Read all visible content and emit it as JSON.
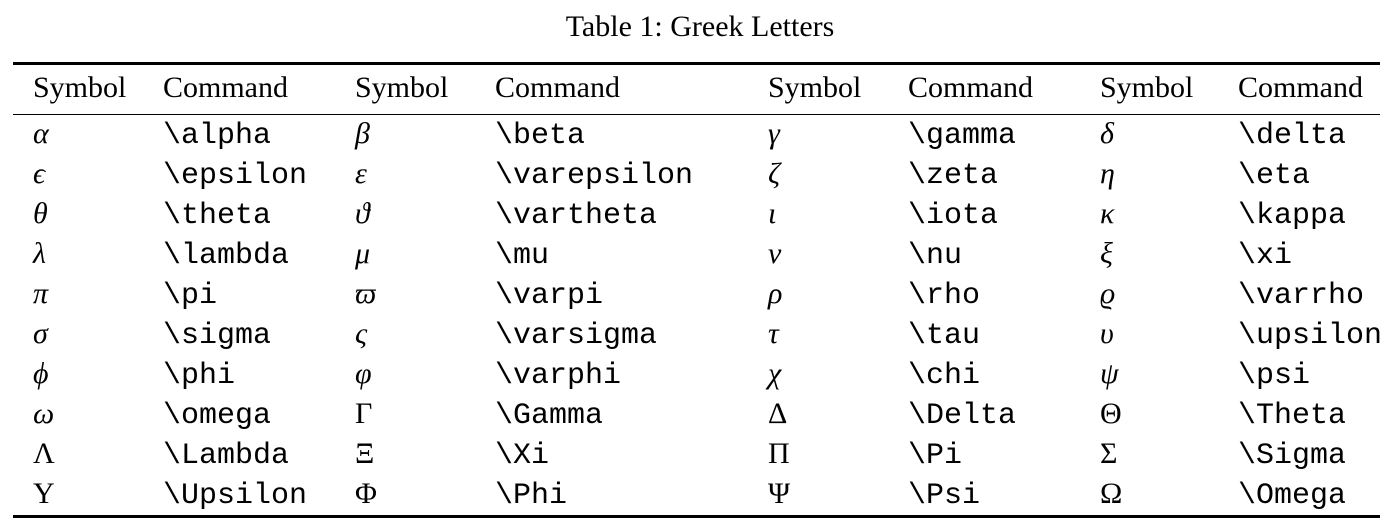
{
  "caption": "Table 1: Greek Letters",
  "table": {
    "headers": [
      "Symbol",
      "Command",
      "Symbol",
      "Command",
      "Symbol",
      "Command",
      "Symbol",
      "Command"
    ],
    "rows": [
      [
        "α",
        "\\alpha",
        "β",
        "\\beta",
        "γ",
        "\\gamma",
        "δ",
        "\\delta"
      ],
      [
        "ϵ",
        "\\epsilon",
        "ε",
        "\\varepsilon",
        "ζ",
        "\\zeta",
        "η",
        "\\eta"
      ],
      [
        "θ",
        "\\theta",
        "ϑ",
        "\\vartheta",
        "ι",
        "\\iota",
        "κ",
        "\\kappa"
      ],
      [
        "λ",
        "\\lambda",
        "μ",
        "\\mu",
        "ν",
        "\\nu",
        "ξ",
        "\\xi"
      ],
      [
        "π",
        "\\pi",
        "ϖ",
        "\\varpi",
        "ρ",
        "\\rho",
        "ϱ",
        "\\varrho"
      ],
      [
        "σ",
        "\\sigma",
        "ς",
        "\\varsigma",
        "τ",
        "\\tau",
        "υ",
        "\\upsilon"
      ],
      [
        "ϕ",
        "\\phi",
        "φ",
        "\\varphi",
        "χ",
        "\\chi",
        "ψ",
        "\\psi"
      ],
      [
        "ω",
        "\\omega",
        "Γ",
        "\\Gamma",
        "Δ",
        "\\Delta",
        "Θ",
        "\\Theta"
      ],
      [
        "Λ",
        "\\Lambda",
        "Ξ",
        "\\Xi",
        "Π",
        "\\Pi",
        "Σ",
        "\\Sigma"
      ],
      [
        "Υ",
        "\\Upsilon",
        "Φ",
        "\\Phi",
        "Ψ",
        "\\Psi",
        "Ω",
        "\\Omega"
      ]
    ],
    "uppercase_symbol_rows": [
      7,
      8,
      9
    ],
    "colors": {
      "text": "#000000",
      "rule": "#000000",
      "background": "#ffffff"
    }
  }
}
